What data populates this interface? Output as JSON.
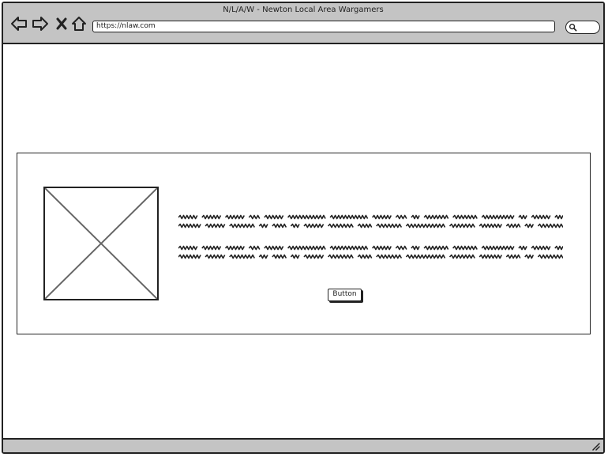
{
  "window": {
    "title": "N/L/A/W - Newton Local Area Wargamers"
  },
  "toolbar": {
    "back_icon": "arrow-left-icon",
    "forward_icon": "arrow-right-icon",
    "close_icon": "close-icon",
    "home_icon": "home-icon",
    "url": "https://nlaw.com",
    "search_icon": "search-icon"
  },
  "card": {
    "image_icon": "image-placeholder-icon",
    "paragraph_1_lines": 2,
    "paragraph_2_lines": 2,
    "button_label": "Button"
  },
  "colors": {
    "chrome": "#c4c4c4",
    "stroke": "#222222",
    "background": "#ffffff"
  }
}
